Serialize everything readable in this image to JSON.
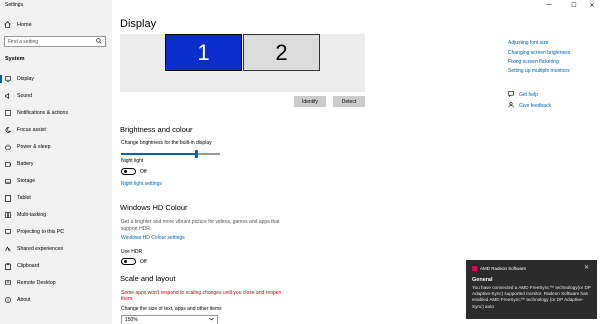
{
  "window": {
    "title": "Settings",
    "controls": {
      "minimize": "—",
      "maximize": "☐",
      "close": "✕"
    }
  },
  "sidebar": {
    "home_label": "Home",
    "search_placeholder": "Find a setting",
    "section_label": "System",
    "items": [
      {
        "label": "Display",
        "icon": "monitor-icon",
        "active": true
      },
      {
        "label": "Sound",
        "icon": "speaker-icon"
      },
      {
        "label": "Notifications & actions",
        "icon": "notification-icon"
      },
      {
        "label": "Focus assist",
        "icon": "moon-icon"
      },
      {
        "label": "Power & sleep",
        "icon": "power-icon"
      },
      {
        "label": "Battery",
        "icon": "battery-icon"
      },
      {
        "label": "Storage",
        "icon": "storage-icon"
      },
      {
        "label": "Tablet",
        "icon": "tablet-icon"
      },
      {
        "label": "Multi-tasking",
        "icon": "multitask-icon"
      },
      {
        "label": "Projecting to this PC",
        "icon": "projector-icon"
      },
      {
        "label": "Shared experiences",
        "icon": "shared-icon"
      },
      {
        "label": "Clipboard",
        "icon": "clipboard-icon"
      },
      {
        "label": "Remote Desktop",
        "icon": "remote-icon"
      },
      {
        "label": "About",
        "icon": "info-icon"
      }
    ]
  },
  "main": {
    "title": "Display",
    "monitors": {
      "one": "1",
      "two": "2"
    },
    "identify_label": "Identify",
    "detect_label": "Detect",
    "brightness": {
      "heading": "Brightness and colour",
      "slider_label": "Change brightness for the built-in display",
      "level": 0.76,
      "night_light_label": "Night light",
      "night_light_state": "Off",
      "night_light_link": "Night light settings"
    },
    "hdr": {
      "heading": "Windows HD Colour",
      "description_line1": "Get a brighter and more vibrant picture for videos, games and apps that",
      "description_line2": "support HDR.",
      "link": "Windows HD Colour settings",
      "use_hdr_label": "Use HDR",
      "use_hdr_state": "Off"
    },
    "scale": {
      "heading": "Scale and layout",
      "warning_line1": "Some apps won't respond to scaling changes until you close and reopen",
      "warning_line2": "them.",
      "size_label": "Change the size of text, apps and other items",
      "size_value": "150%"
    }
  },
  "related": {
    "links": [
      "Adjusting font size",
      "Changing screen brightness",
      "Fixing screen flickering",
      "Setting up multiple monitors"
    ],
    "get_help": "Get help",
    "give_feedback": "Give feedback"
  },
  "toast": {
    "app_name": "AMD Radeon Software",
    "title": "General",
    "body": "You have connected a AMD FreeSync™ technology(or DP Adaptive-Sync) supported monitor. Radeon Software has enabled AMD FreeSync™ technology (or DP Adaptive-Sync) auto",
    "close": "✕",
    "accent": "#e4005a"
  },
  "colors": {
    "accent": "#0063b1",
    "monitor_selected": "#0a2ecb",
    "warning": "#d10000",
    "sidebar_bg": "#f2f2f2"
  }
}
